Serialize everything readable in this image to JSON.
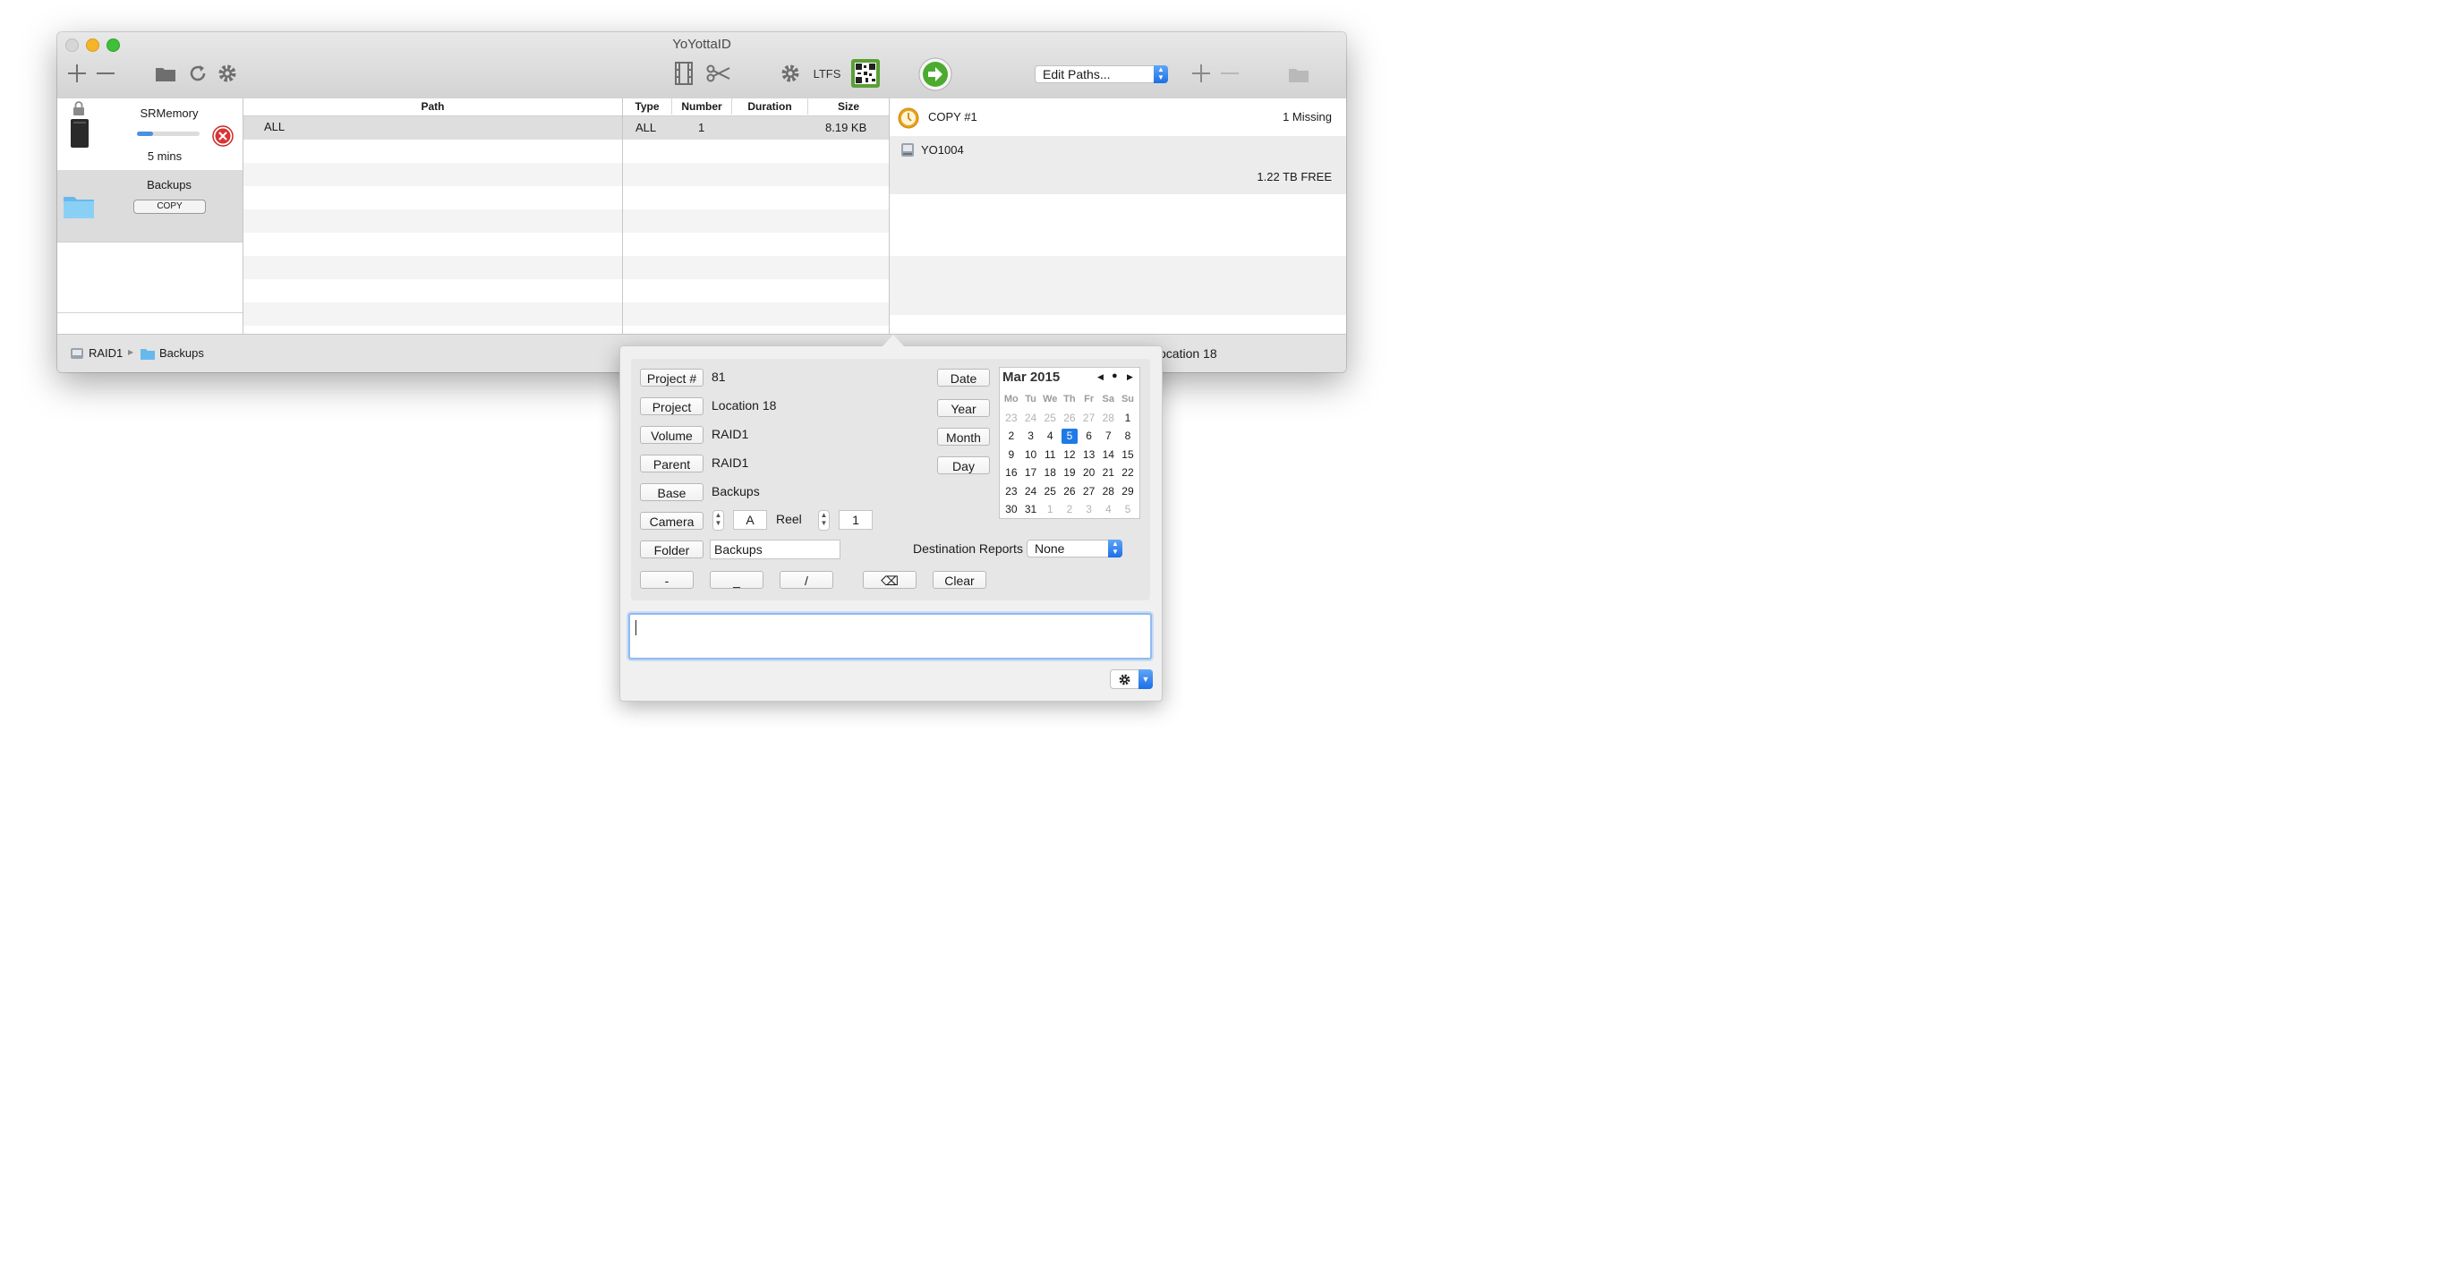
{
  "window": {
    "title": "YoYottaID"
  },
  "toolbar": {
    "ltfs_label": "LTFS",
    "edit_paths": "Edit Paths..."
  },
  "sidebar": {
    "items": [
      {
        "name": "SRMemory",
        "status": "5 mins",
        "progress": 0.25
      },
      {
        "name": "Backups",
        "badge": "COPY"
      }
    ]
  },
  "table": {
    "headers": {
      "path": "Path",
      "type": "Type",
      "number": "Number",
      "duration": "Duration",
      "size": "Size"
    },
    "rows": [
      {
        "path": "ALL",
        "type": "ALL",
        "number": "1",
        "duration": "",
        "size": "8.19 KB"
      }
    ]
  },
  "destinations": {
    "copy_label": "COPY #1",
    "copy_status": "1 Missing",
    "volume": "YO1004",
    "free": "1.22 TB FREE"
  },
  "statusbar": {
    "breadcrumb": [
      "RAID1",
      "Backups"
    ],
    "right_text": "ocation 18"
  },
  "popover": {
    "fields": [
      {
        "label": "Project #",
        "value": "81"
      },
      {
        "label": "Project",
        "value": "Location 18"
      },
      {
        "label": "Volume",
        "value": "RAID1"
      },
      {
        "label": "Parent",
        "value": "RAID1"
      },
      {
        "label": "Base",
        "value": "Backups"
      }
    ],
    "camera_label": "Camera",
    "camera_value": "A",
    "reel_label": "Reel",
    "reel_value": "1",
    "folder_label": "Folder",
    "folder_value": "Backups",
    "date_buttons": [
      "Date",
      "Year",
      "Month",
      "Day"
    ],
    "destination_reports_label": "Destination Reports",
    "destination_reports_value": "None",
    "separator_buttons": [
      "-",
      "_",
      "/"
    ],
    "backspace_symbol": "⌫",
    "clear_label": "Clear",
    "calendar": {
      "month_label": "Mar 2015",
      "day_headers": [
        "Mo",
        "Tu",
        "We",
        "Th",
        "Fr",
        "Sa",
        "Su"
      ],
      "selected_day": "5",
      "weeks": [
        [
          "23",
          "24",
          "25",
          "26",
          "27",
          "28",
          "1"
        ],
        [
          "2",
          "3",
          "4",
          "5",
          "6",
          "7",
          "8"
        ],
        [
          "9",
          "10",
          "11",
          "12",
          "13",
          "14",
          "15"
        ],
        [
          "16",
          "17",
          "18",
          "19",
          "20",
          "21",
          "22"
        ],
        [
          "23",
          "24",
          "25",
          "26",
          "27",
          "28",
          "29"
        ],
        [
          "30",
          "31",
          "1",
          "2",
          "3",
          "4",
          "5"
        ]
      ]
    },
    "text_input_value": ""
  },
  "colors": {
    "accent": "#1d7ae6",
    "go_green": "#4cab2f",
    "progress_blue": "#4a90e2"
  }
}
